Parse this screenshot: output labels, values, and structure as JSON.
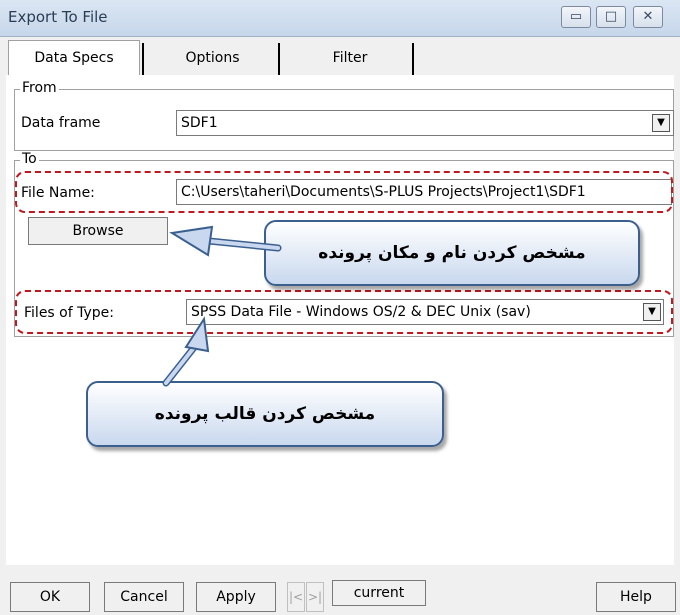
{
  "window": {
    "title": "Export To File"
  },
  "tabs": [
    "Data Specs",
    "Options",
    "Filter"
  ],
  "from_group": {
    "legend": "From",
    "data_frame_label": "Data frame",
    "data_frame_value": "SDF1"
  },
  "to_group": {
    "legend": "To",
    "file_name_label": "File Name:",
    "file_name_value": "C:\\Users\\taheri\\Documents\\S-PLUS Projects\\Project1\\SDF1",
    "browse_label": "Browse",
    "files_of_type_label": "Files of Type:",
    "files_of_type_value": "SPSS Data File - Windows OS/2 & DEC Unix (sav)"
  },
  "annotations": {
    "name_location": "مشخص کردن نام و مکان پرونده",
    "file_format": "مشخص کردن قالب پرونده"
  },
  "buttons": {
    "ok": "OK",
    "cancel": "Cancel",
    "apply": "Apply",
    "first": "|<",
    "next": ">|",
    "current": "current",
    "help": "Help"
  },
  "colors": {
    "highlight": "#c0181e",
    "callout_border": "#3b5f8f",
    "callout_fill": "#c9d8ee"
  }
}
